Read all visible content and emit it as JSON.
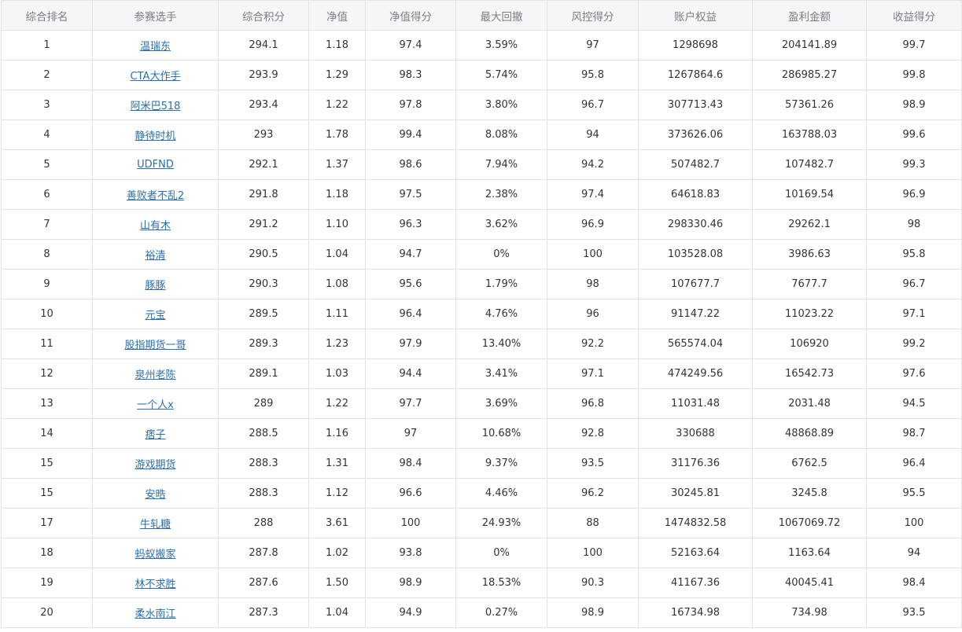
{
  "table": {
    "headers": [
      "综合排名",
      "参赛选手",
      "综合积分",
      "净值",
      "净值得分",
      "最大回撤",
      "风控得分",
      "账户权益",
      "盈利金额",
      "收益得分"
    ],
    "rows": [
      [
        "1",
        "温瑞东",
        "294.1",
        "1.18",
        "97.4",
        "3.59%",
        "97",
        "1298698",
        "204141.89",
        "99.7"
      ],
      [
        "2",
        "CTA大作手",
        "293.9",
        "1.29",
        "98.3",
        "5.74%",
        "95.8",
        "1267864.6",
        "286985.27",
        "99.8"
      ],
      [
        "3",
        "阿米巴518",
        "293.4",
        "1.22",
        "97.8",
        "3.80%",
        "96.7",
        "307713.43",
        "57361.26",
        "98.9"
      ],
      [
        "4",
        "静待时机",
        "293",
        "1.78",
        "99.4",
        "8.08%",
        "94",
        "373626.06",
        "163788.03",
        "99.6"
      ],
      [
        "5",
        "UDFND",
        "292.1",
        "1.37",
        "98.6",
        "7.94%",
        "94.2",
        "507482.7",
        "107482.7",
        "99.3"
      ],
      [
        "6",
        "善败者不乱2",
        "291.8",
        "1.18",
        "97.5",
        "2.38%",
        "97.4",
        "64618.83",
        "10169.54",
        "96.9"
      ],
      [
        "7",
        "山有木",
        "291.2",
        "1.10",
        "96.3",
        "3.62%",
        "96.9",
        "298330.46",
        "29262.1",
        "98"
      ],
      [
        "8",
        "裕清",
        "290.5",
        "1.04",
        "94.7",
        "0%",
        "100",
        "103528.08",
        "3986.63",
        "95.8"
      ],
      [
        "9",
        "豚豚",
        "290.3",
        "1.08",
        "95.6",
        "1.79%",
        "98",
        "107677.7",
        "7677.7",
        "96.7"
      ],
      [
        "10",
        "元宝",
        "289.5",
        "1.11",
        "96.4",
        "4.76%",
        "96",
        "91147.22",
        "11023.22",
        "97.1"
      ],
      [
        "11",
        "股指期货一哥",
        "289.3",
        "1.23",
        "97.9",
        "13.40%",
        "92.2",
        "565574.04",
        "106920",
        "99.2"
      ],
      [
        "12",
        "泉州老陈",
        "289.1",
        "1.03",
        "94.4",
        "3.41%",
        "97.1",
        "474249.56",
        "16542.73",
        "97.6"
      ],
      [
        "13",
        "一个人x",
        "289",
        "1.22",
        "97.7",
        "3.69%",
        "96.8",
        "11031.48",
        "2031.48",
        "94.5"
      ],
      [
        "14",
        "痞子",
        "288.5",
        "1.16",
        "97",
        "10.68%",
        "92.8",
        "330688",
        "48868.89",
        "98.7"
      ],
      [
        "15",
        "游戏期货",
        "288.3",
        "1.31",
        "98.4",
        "9.37%",
        "93.5",
        "31176.36",
        "6762.5",
        "96.4"
      ],
      [
        "15",
        "安晧",
        "288.3",
        "1.12",
        "96.6",
        "4.46%",
        "96.2",
        "30245.81",
        "3245.8",
        "95.5"
      ],
      [
        "17",
        "牛轧糖",
        "288",
        "3.61",
        "100",
        "24.93%",
        "88",
        "1474832.58",
        "1067069.72",
        "100"
      ],
      [
        "18",
        "蚂蚁搬家",
        "287.8",
        "1.02",
        "93.8",
        "0%",
        "100",
        "52163.64",
        "1163.64",
        "94"
      ],
      [
        "19",
        "林不求胜",
        "287.6",
        "1.50",
        "98.9",
        "18.53%",
        "90.3",
        "41167.36",
        "40045.41",
        "98.4"
      ],
      [
        "20",
        "柔水南江",
        "287.3",
        "1.04",
        "94.9",
        "0.27%",
        "98.9",
        "16734.98",
        "734.98",
        "93.5"
      ]
    ]
  }
}
